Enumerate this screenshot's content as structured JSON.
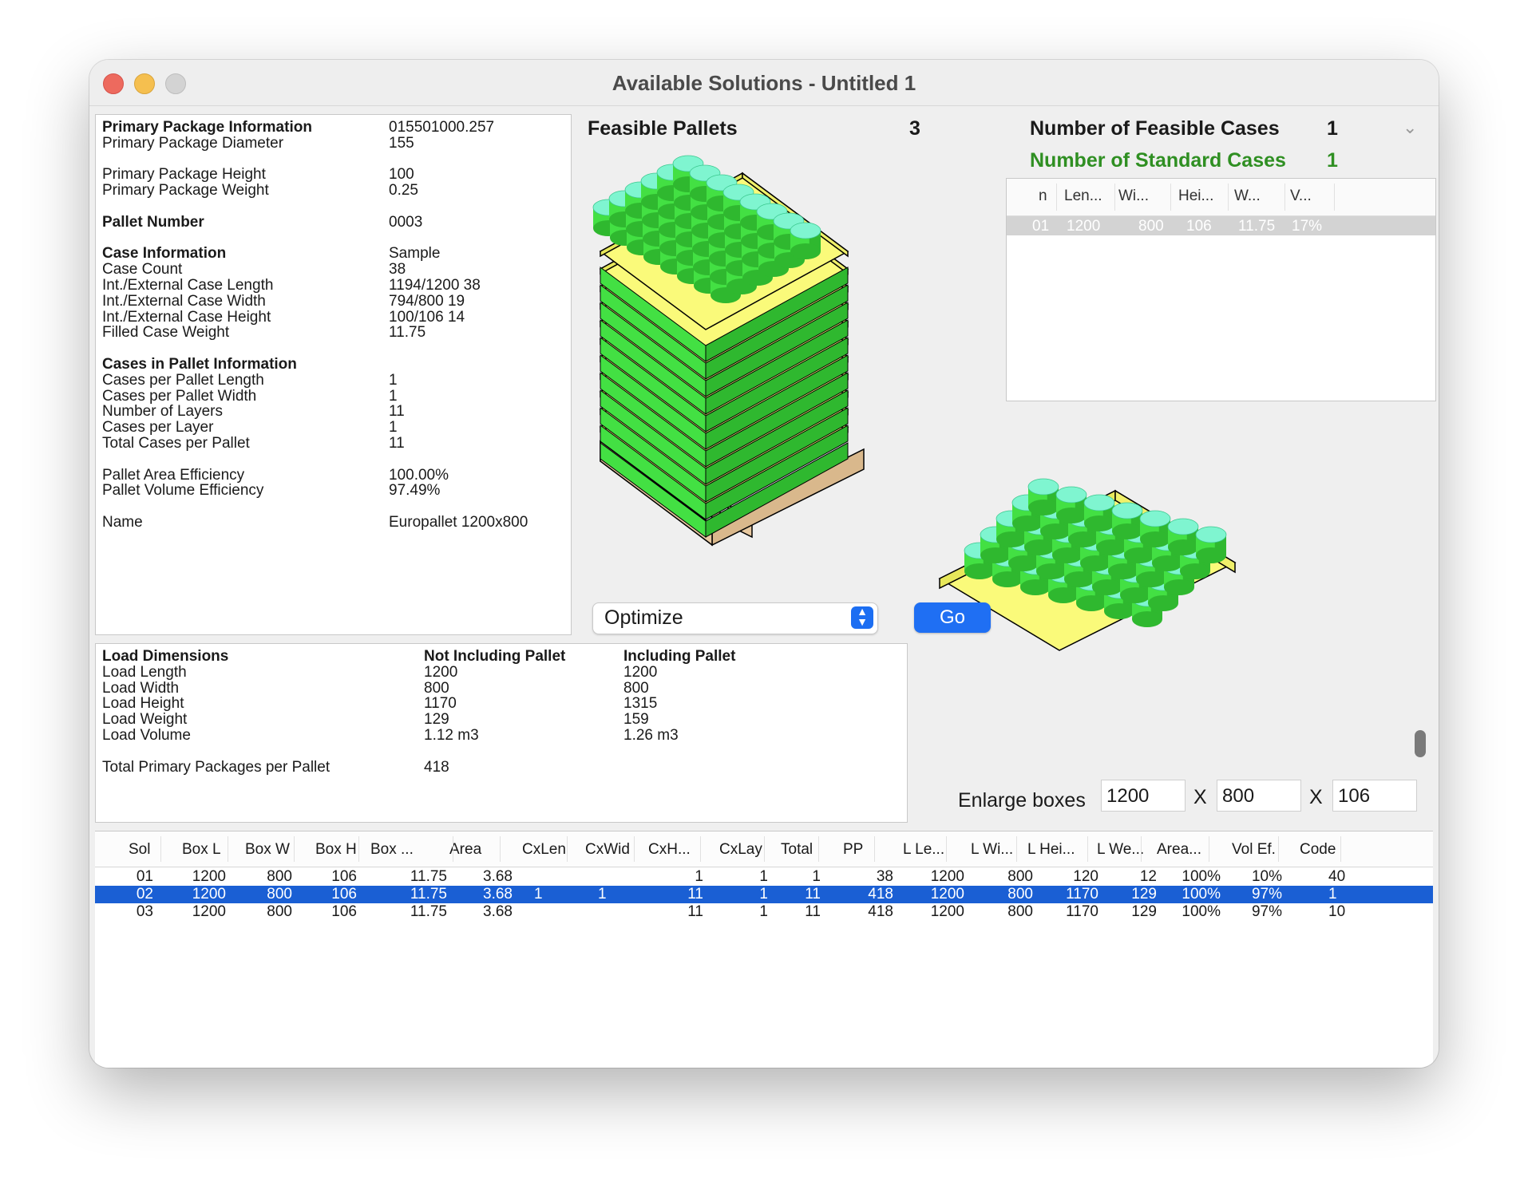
{
  "window": {
    "title": "Available Solutions - Untitled 1"
  },
  "info": [
    {
      "label": "Primary Package Information",
      "value": "015501000.257",
      "bold": true
    },
    {
      "label": "Primary Package Diameter",
      "value": "155"
    },
    {
      "label": "",
      "value": ""
    },
    {
      "label": "Primary Package Height",
      "value": "100"
    },
    {
      "label": "Primary Package Weight",
      "value": "0.25"
    },
    {
      "label": "",
      "value": ""
    },
    {
      "label": "Pallet Number",
      "value": "0003",
      "bold": true
    },
    {
      "label": "",
      "value": ""
    },
    {
      "label": "Case Information",
      "value": "Sample",
      "bold": true
    },
    {
      "label": "Case Count",
      "value": "38"
    },
    {
      "label": "Int./External Case Length",
      "value": "1194/1200   38"
    },
    {
      "label": "Int./External Case Width",
      "value": "794/800   19"
    },
    {
      "label": "Int./External Case Height",
      "value": "100/106   14"
    },
    {
      "label": "Filled Case Weight",
      "value": "11.75"
    },
    {
      "label": "",
      "value": ""
    },
    {
      "label": "Cases in Pallet Information",
      "value": "",
      "bold": true
    },
    {
      "label": "Cases per Pallet Length",
      "value": "1"
    },
    {
      "label": "Cases per Pallet Width",
      "value": "1"
    },
    {
      "label": "Number of Layers",
      "value": "11"
    },
    {
      "label": "Cases per Layer",
      "value": "1"
    },
    {
      "label": "Total Cases per Pallet",
      "value": "11"
    },
    {
      "label": "",
      "value": ""
    },
    {
      "label": "Pallet Area Efficiency",
      "value": "100.00%"
    },
    {
      "label": "Pallet Volume Efficiency",
      "value": "97.49%"
    },
    {
      "label": "",
      "value": ""
    },
    {
      "label": "Name",
      "value": "Europallet 1200x800"
    }
  ],
  "load": [
    {
      "label": "Load Dimensions",
      "a": "Not Including Pallet",
      "b": "Including Pallet",
      "bold": true
    },
    {
      "label": "Load Length",
      "a": "1200",
      "b": "1200"
    },
    {
      "label": "Load Width",
      "a": "800",
      "b": "800"
    },
    {
      "label": "Load Height",
      "a": "1170",
      "b": "1315"
    },
    {
      "label": "Load Weight",
      "a": "129",
      "b": "159"
    },
    {
      "label": "Load Volume",
      "a": "1.12 m3",
      "b": "1.26 m3"
    },
    {
      "label": "",
      "a": "",
      "b": ""
    },
    {
      "label": "Total Primary Packages per Pallet",
      "a": "418",
      "b": ""
    }
  ],
  "feasible": {
    "label": "Feasible Pallets",
    "count": "3"
  },
  "cases": {
    "feasible_label": "Number of Feasible Cases",
    "feasible_count": "1",
    "standard_label": "Number of Standard Cases",
    "standard_count": "1"
  },
  "cases_table": {
    "headers": [
      "n",
      "Len...",
      "Wi...",
      "Hei...",
      "W...",
      "V..."
    ],
    "rows": [
      [
        "01",
        "1200",
        "800",
        "106",
        "11.75",
        "17%"
      ]
    ]
  },
  "controls": {
    "optimize": "Optimize",
    "go": "Go",
    "enlarge_label": "Enlarge boxes",
    "x_sep": "X",
    "enlarge_l": "1200",
    "enlarge_w": "800",
    "enlarge_h": "106"
  },
  "solutions": {
    "headers": [
      "Sol",
      "Box L",
      "Box W",
      "Box H",
      "Box ...",
      "Area",
      "CxLen",
      "CxWid",
      "CxH...",
      "CxLay",
      "Total",
      "PP",
      "L Le...",
      "L Wi...",
      "L Hei...",
      "L We...",
      "Area...",
      "Vol Ef.",
      "Code"
    ],
    "rows": [
      [
        "01",
        "1200",
        "800",
        "106",
        "11.75",
        "3.68",
        "",
        "",
        "1",
        "1",
        "1",
        "38",
        "1200",
        "800",
        "120",
        "12",
        "100%",
        "10%",
        "40"
      ],
      [
        "02",
        "1200",
        "800",
        "106",
        "11.75",
        "3.68",
        "1",
        "1",
        "11",
        "1",
        "11",
        "418",
        "1200",
        "800",
        "1170",
        "129",
        "100%",
        "97%",
        "1"
      ],
      [
        "03",
        "1200",
        "800",
        "106",
        "11.75",
        "3.68",
        "",
        "",
        "11",
        "1",
        "11",
        "418",
        "1200",
        "800",
        "1170",
        "129",
        "100%",
        "97%",
        "10"
      ]
    ],
    "selected_index": 1
  },
  "colors": {
    "cylinder_top": "#7ff5d0",
    "cylinder_side": "#43e043",
    "cylinder_dark": "#2fb82f",
    "tray": "#fafa7a",
    "pallet_wood": "#e8c9a0",
    "accent": "#1f6ff3",
    "standard_green": "#2f8f22"
  }
}
